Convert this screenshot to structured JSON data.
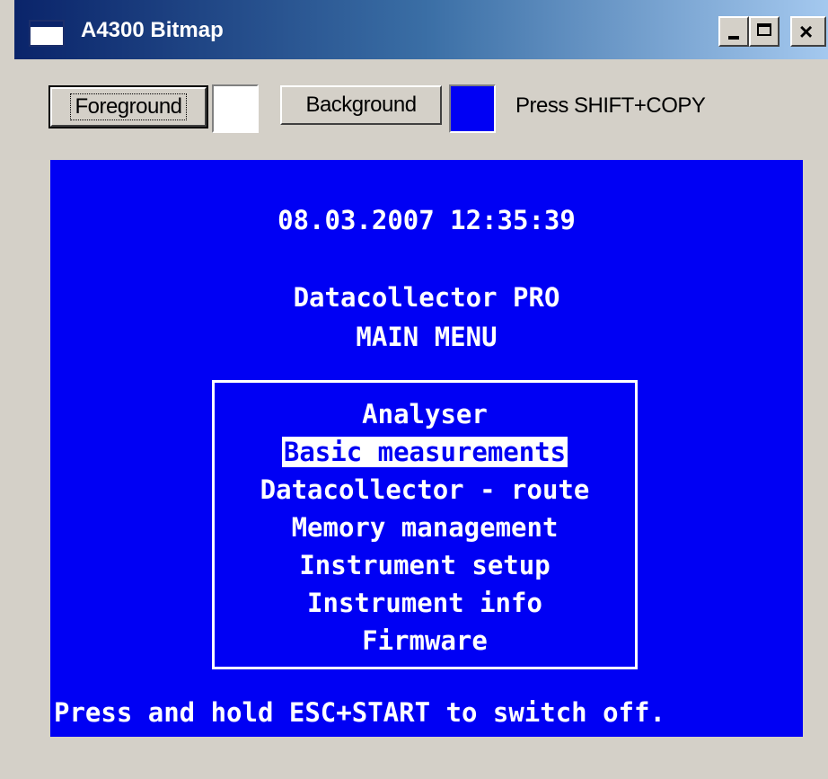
{
  "window": {
    "title": "A4300 Bitmap",
    "controls": {
      "minimize": "minimize",
      "maximize": "maximize",
      "close": "×"
    }
  },
  "toolbar": {
    "foreground_label": "Foreground",
    "foreground_color": "#ffffff",
    "background_label": "Background",
    "background_color": "#0000f4",
    "hint": "Press SHIFT+COPY"
  },
  "screen": {
    "datetime": "08.03.2007 12:35:39",
    "app_name": "Datacollector PRO",
    "menu_title": "MAIN MENU",
    "menu_items": [
      "Analyser",
      "Basic measurements",
      "Datacollector - route",
      "Memory management",
      "Instrument setup",
      "Instrument info",
      "Firmware"
    ],
    "selected_index": 1,
    "footer": "Press and hold ESC+START to switch off."
  }
}
